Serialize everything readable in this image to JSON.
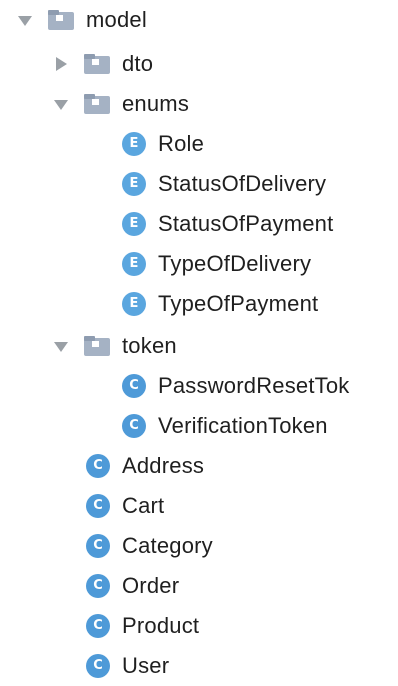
{
  "tree": {
    "model": {
      "label": "model",
      "icon": "folder-icon",
      "expanded": true
    },
    "dto": {
      "label": "dto",
      "icon": "folder-icon",
      "expanded": false
    },
    "enums": {
      "label": "enums",
      "icon": "folder-icon",
      "expanded": true,
      "badge": "E",
      "items": [
        "Role",
        "StatusOfDelivery",
        "StatusOfPayment",
        "TypeOfDelivery",
        "TypeOfPayment"
      ]
    },
    "token": {
      "label": "token",
      "icon": "folder-icon",
      "expanded": true,
      "badge": "C",
      "items": [
        "PasswordResetTok",
        "VerificationToken"
      ]
    },
    "classes": {
      "badge": "C",
      "items": [
        "Address",
        "Cart",
        "Category",
        "Order",
        "Product",
        "User"
      ]
    }
  },
  "colors": {
    "folder": "#a5b2c4",
    "folder_tab": "#8e9cb0",
    "badge_enum": "#5aa6df",
    "badge_class": "#4e9ad8",
    "arrow": "#9aa0a6",
    "text": "#1f1f1f"
  }
}
